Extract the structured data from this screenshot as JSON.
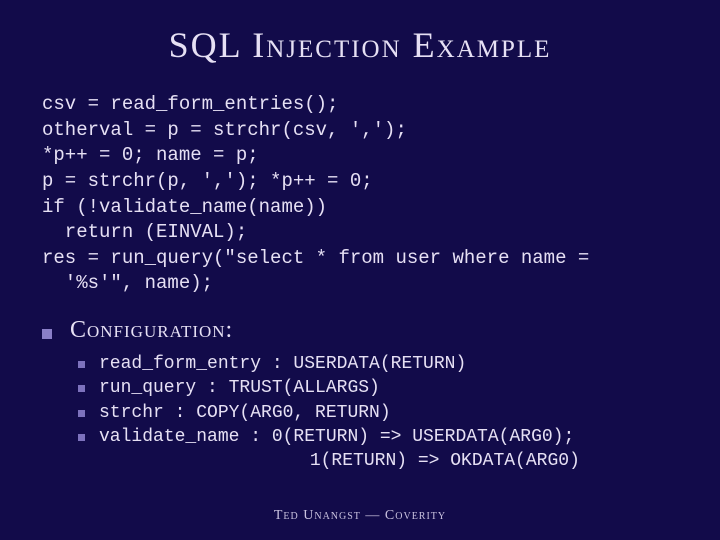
{
  "title": "SQL Injection Example",
  "code": "csv = read_form_entries();\notherval = p = strchr(csv, ',');\n*p++ = 0; name = p;\np = strchr(p, ','); *p++ = 0;\nif (!validate_name(name))\n  return (EINVAL);\nres = run_query(\"select * from user where name =\n  '%s'\", name);",
  "config_label": "Configuration:",
  "config_items": [
    "read_form_entry : USERDATA(RETURN)",
    "run_query : TRUST(ALLARGS)",
    "strchr : COPY(ARG0, RETURN)",
    "validate_name : 0(RETURN) => USERDATA(ARG0);"
  ],
  "config_continuation": "                1(RETURN) => OKDATA(ARG0)",
  "footer": "Ted Unangst — Coverity"
}
